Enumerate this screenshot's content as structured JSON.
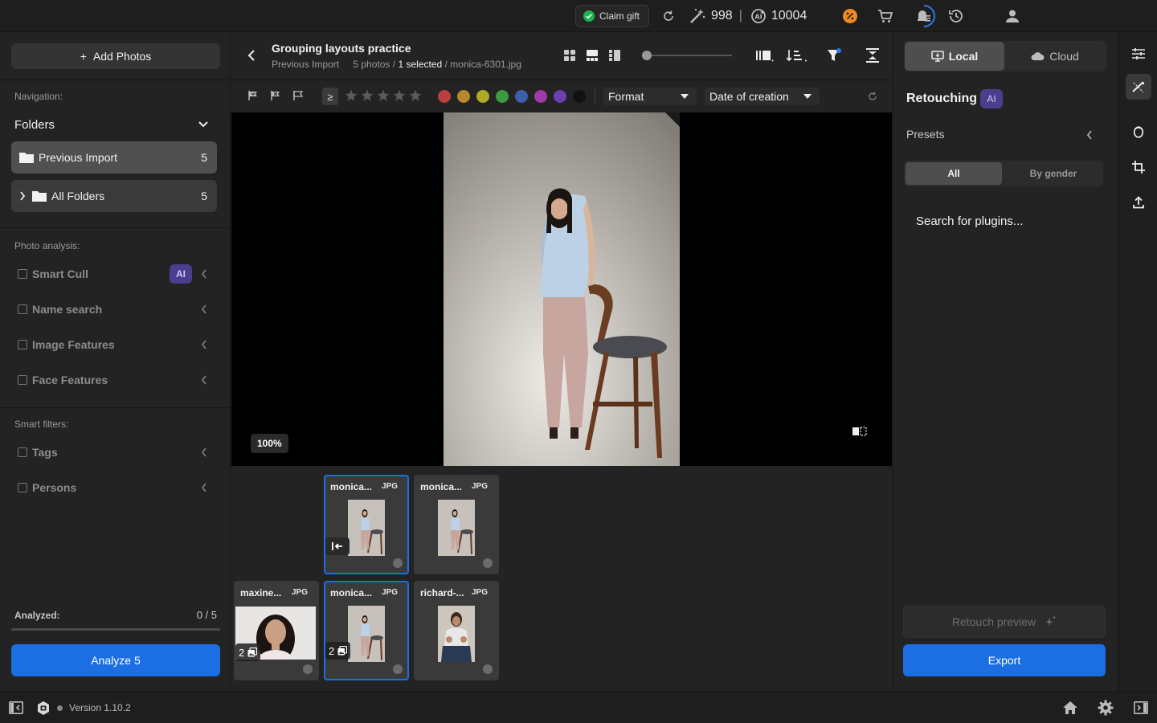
{
  "topbar": {
    "claim_gift": "Claim gift",
    "credits_a": "998",
    "separator": "|",
    "credits_b": "10004",
    "icons": [
      "refresh-icon",
      "magic-wand-icon",
      "ai-credits-icon",
      "discount-icon",
      "cart-icon",
      "notifications-icon",
      "history-icon",
      "user-icon"
    ]
  },
  "left": {
    "add_photos": "Add Photos",
    "add_symbol": "+",
    "navigation_label": "Navigation:",
    "folders_label": "Folders",
    "folders": [
      {
        "label": "Previous Import",
        "count": "5"
      },
      {
        "label": "All Folders",
        "count": "5"
      }
    ],
    "photo_analysis_label": "Photo analysis:",
    "analysis_filters": [
      "Smart Cull",
      "Name search",
      "Image Features",
      "Face Features"
    ],
    "ai_badge": "AI",
    "smart_filters_label": "Smart filters:",
    "smart_filters": [
      "Tags",
      "Persons"
    ],
    "analyzed_label": "Analyzed:",
    "analyzed_value": "0 / 5",
    "analyzed_progress": 0,
    "analyze_button": "Analyze 5"
  },
  "center": {
    "title": "Grouping layouts practice",
    "breadcrumb_folder": "Previous Import",
    "photos_count": "5 photos /",
    "selected_count": "1 selected",
    "selected_sep": "/",
    "selected_file": "monica-6301.jpg",
    "zoom_level": "100%",
    "rating_operator": "≥",
    "stars": 5,
    "color_labels": [
      "#b94040",
      "#b8862b",
      "#b0a828",
      "#3e9a3e",
      "#3f5fae",
      "#a03aa8",
      "#6a3fb0",
      "#111111"
    ],
    "format_dropdown": "Format",
    "sort_dropdown": "Date of creation",
    "thumbnails": [
      {
        "name": "monica...",
        "format": "JPG",
        "selected": true,
        "stack": "",
        "kind": "monica"
      },
      {
        "name": "monica...",
        "format": "JPG",
        "selected": false,
        "stack": "",
        "kind": "monica"
      },
      {
        "name": "maxine...",
        "format": "JPG",
        "selected": false,
        "stack": "2",
        "kind": "maxine"
      },
      {
        "name": "monica...",
        "format": "JPG",
        "selected": true,
        "stack": "2",
        "kind": "monica"
      },
      {
        "name": "richard-...",
        "format": "JPG",
        "selected": false,
        "stack": "",
        "kind": "richard"
      }
    ]
  },
  "right": {
    "local_tab": "Local",
    "cloud_tab": "Cloud",
    "retouching": "Retouching",
    "ai_badge": "AI",
    "presets": "Presets",
    "filter_all": "All",
    "filter_gender": "By gender",
    "search_plugins": "Search for plugins...",
    "retouch_preview": "Retouch preview",
    "export": "Export"
  },
  "bottombar": {
    "version": "Version 1.10.2"
  },
  "colors": {
    "accent": "#1c6fe3",
    "ai_badge_bg": "#4a3f8e",
    "check_green": "#1fb352",
    "discount_orange": "#f08a24"
  }
}
